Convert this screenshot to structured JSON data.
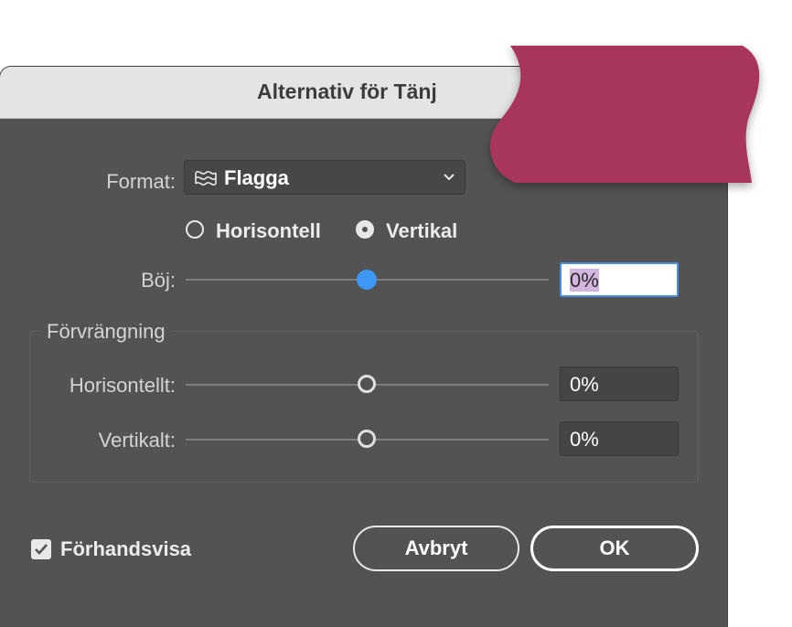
{
  "dialog": {
    "title": "Alternativ för Tänj"
  },
  "format": {
    "label": "Format:",
    "value": "Flagga",
    "icon": "flag-wave-icon"
  },
  "orientation": {
    "options": [
      {
        "label": "Horisontell",
        "selected": false
      },
      {
        "label": "Vertikal",
        "selected": true
      }
    ]
  },
  "bend": {
    "label": "Böj:",
    "value": "0%",
    "slider_fraction": 0.5
  },
  "distortion": {
    "group_label": "Förvrängning",
    "horizontal": {
      "label": "Horisontellt:",
      "value": "0%",
      "slider_fraction": 0.5
    },
    "vertical": {
      "label": "Vertikalt:",
      "value": "0%",
      "slider_fraction": 0.5
    }
  },
  "preview": {
    "label": "Förhandsvisa",
    "checked": true
  },
  "buttons": {
    "cancel": "Avbryt",
    "ok": "OK"
  },
  "colors": {
    "dialog_bg": "#535353",
    "titlebar_bg": "#e4e4e4",
    "accent_blue": "#3d98f5",
    "flag": "#a8365c"
  }
}
